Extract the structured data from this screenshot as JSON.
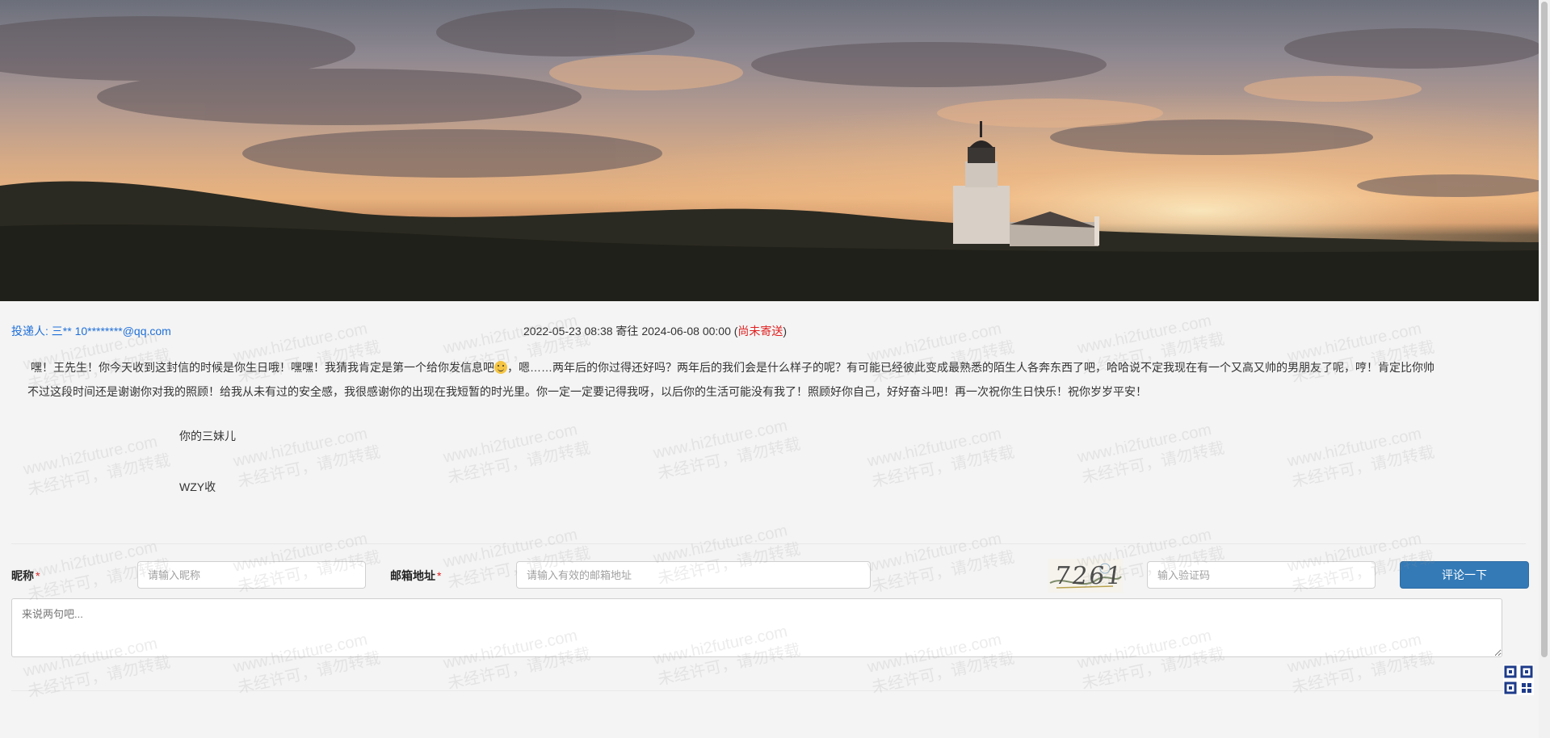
{
  "sender": {
    "label": "投递人: 三** 10********@qq.com"
  },
  "dates": {
    "text": "2022-05-23 08:38 寄往 2024-06-08 00:00 (",
    "status": "尚未寄送",
    "close": ")"
  },
  "letter": {
    "para1_before_emoji": "嘿！王先生！你今天收到这封信的时候是你生日哦！嘿嘿！我猜我肯定是第一个给你发信息吧",
    "para1_after_emoji": "，嗯……两年后的你过得还好吗？两年后的我们会是什么样子的呢？有可能已经彼此变成最熟悉的陌生人各奔东西了吧，哈哈说不定我现在有一个又高又帅的男朋友了呢，哼！肯定比你帅",
    "para2": "不过这段时间还是谢谢你对我的照顾！给我从未有过的安全感，我很感谢你的出现在我短暂的时光里。你一定一定要记得我呀，以后你的生活可能没有我了！照顾好你自己，好好奋斗吧！再一次祝你生日快乐！祝你岁岁平安！",
    "signature_from": "你的三妹儿",
    "signature_to": "WZY收",
    "emoji_icon": "smile-emoji-icon"
  },
  "form": {
    "nickname_label": "昵称",
    "nickname_placeholder": "请输入昵称",
    "email_label": "邮箱地址",
    "email_placeholder": "请输入有效的邮箱地址",
    "required_mark": "*",
    "captcha_text": "7261",
    "code_placeholder": "输入验证码",
    "submit_label": "评论一下",
    "comment_placeholder": "来说两句吧..."
  },
  "watermark": {
    "line1": "www.hi2future.com",
    "line2": "未经许可，请勿转载"
  },
  "icons": {
    "qr": "qr-code-icon"
  },
  "colors": {
    "link": "#1e6fd9",
    "status": "#e02020",
    "button": "#337ab7"
  }
}
